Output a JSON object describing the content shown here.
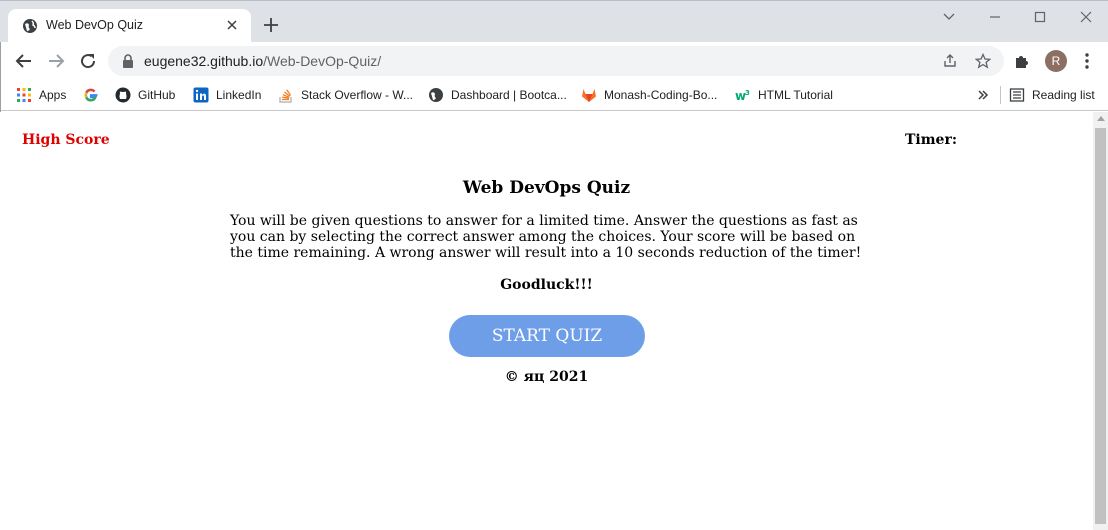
{
  "browser": {
    "tab_title": "Web DevOp Quiz",
    "url_host": "eugene32.github.io",
    "url_path": "/Web-DevOp-Quiz/",
    "profile_initial": "R",
    "bookmarks": [
      {
        "label": "Apps",
        "icon": "apps-grid-icon"
      },
      {
        "label": "",
        "icon": "google-icon"
      },
      {
        "label": "GitHub",
        "icon": "github-icon"
      },
      {
        "label": "LinkedIn",
        "icon": "linkedin-icon"
      },
      {
        "label": "Stack Overflow - W...",
        "icon": "stackoverflow-icon"
      },
      {
        "label": "Dashboard | Bootca...",
        "icon": "globe-icon"
      },
      {
        "label": "Monash-Coding-Bo...",
        "icon": "gitlab-icon"
      },
      {
        "label": "HTML Tutorial",
        "icon": "w3schools-icon"
      }
    ],
    "reading_list": "Reading list",
    "colors": {
      "tab_bar": "#dee1e6",
      "omnibox": "#f1f3f4"
    }
  },
  "page": {
    "high_score": "High Score",
    "timer_label": "Timer:",
    "title": "Web DevOps Quiz",
    "instructions": "You will be given questions to answer for a limited time. Answer the questions as fast as you can by selecting the correct answer among the choices. Your score will be based on the time remaining. A wrong answer will result into a 10 seconds reduction of the timer!",
    "goodluck": "Goodluck!!!",
    "start_button": "START QUIZ",
    "footer": "© яц 2021",
    "colors": {
      "high_score": "#e00000",
      "start_button": "#6f9ee8"
    }
  }
}
